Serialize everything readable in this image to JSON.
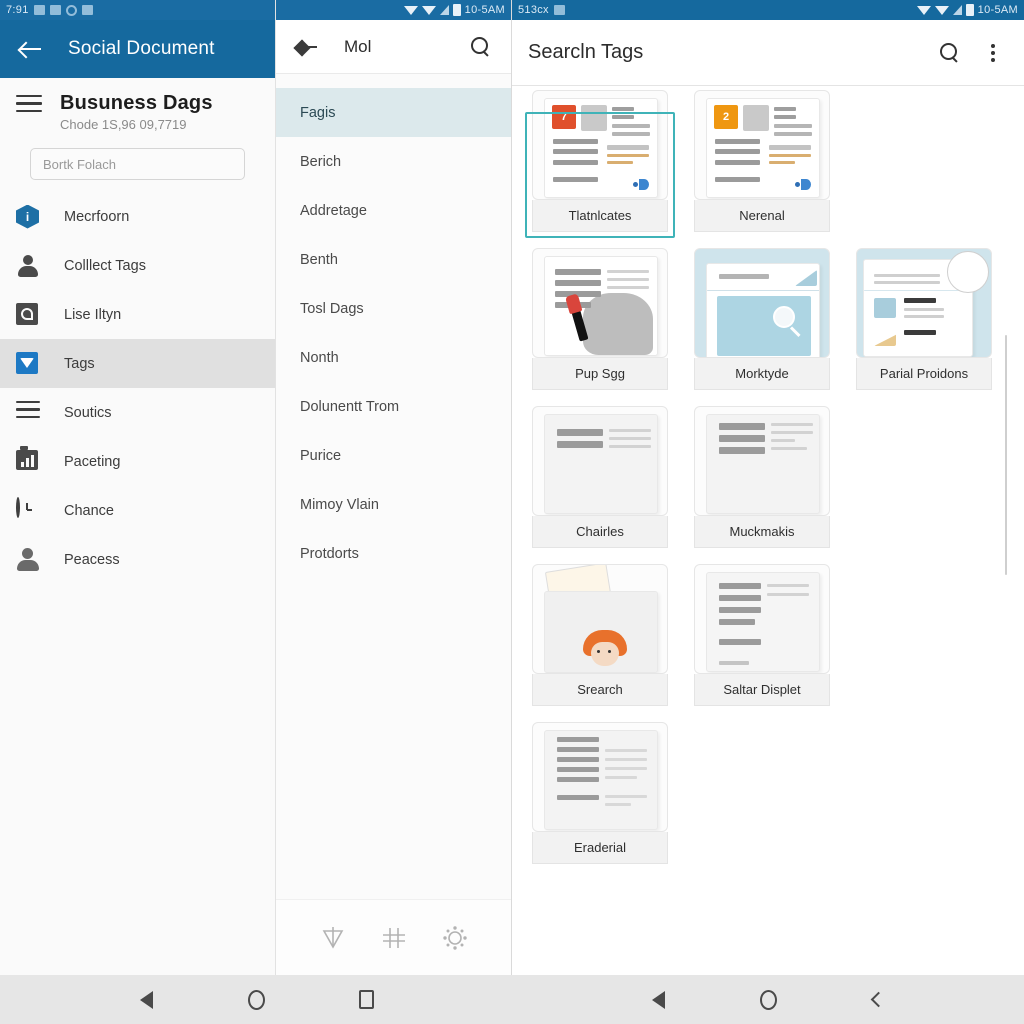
{
  "left_pane": {
    "status": {
      "time": "7:91",
      "icons": [
        "mail-icon",
        "save-icon",
        "sync-icon",
        "app-icon"
      ]
    },
    "appbar": {
      "back": "back-arrow",
      "title": "Social Document"
    },
    "header": {
      "menu": "hamburger-menu",
      "title": "Busuness Dags",
      "subtitle": "Chode 1S,96 09,7719"
    },
    "search": {
      "placeholder": "Bortk Folach",
      "value": ""
    },
    "items": [
      {
        "label": "Mecrfoorn",
        "icon": "info-hexagon-icon",
        "active": false
      },
      {
        "label": "Colllect Tags",
        "icon": "person-icon",
        "active": false
      },
      {
        "label": "Lise Iltyn",
        "icon": "square-leaf-icon",
        "active": false
      },
      {
        "label": "Tags",
        "icon": "twitter-bird-icon",
        "active": true
      },
      {
        "label": "Soutics",
        "icon": "list-lines-icon",
        "active": false
      },
      {
        "label": "Paceting",
        "icon": "bar-chart-icon",
        "active": false
      },
      {
        "label": "Chance",
        "icon": "clock-icon",
        "active": false
      },
      {
        "label": "Peacess",
        "icon": "contact-person-icon",
        "active": false
      }
    ]
  },
  "mid_pane": {
    "status": {
      "time": "10-5AM"
    },
    "appbar": {
      "back": "back-arrow",
      "title": "Mol",
      "search": "search-icon"
    },
    "items": [
      {
        "label": "Fagis",
        "selected": true
      },
      {
        "label": "Berich",
        "selected": false
      },
      {
        "label": "Addretage",
        "selected": false
      },
      {
        "label": "Benth",
        "selected": false
      },
      {
        "label": "Tosl Dags",
        "selected": false
      },
      {
        "label": "Nonth",
        "selected": false
      },
      {
        "label": "Dolunentt Trom",
        "selected": false
      },
      {
        "label": "Purice",
        "selected": false
      },
      {
        "label": "Mimoy Vlain",
        "selected": false
      },
      {
        "label": "Protdorts",
        "selected": false
      }
    ],
    "toolbar": [
      {
        "icon": "filter-triangle-icon"
      },
      {
        "icon": "grid-hash-icon"
      },
      {
        "icon": "settings-sun-icon"
      }
    ]
  },
  "right_pane": {
    "status": {
      "label": "513cx",
      "time": "10-5AM"
    },
    "appbar": {
      "title": "Searcln Tags",
      "search": "search-icon",
      "more": "kebab-menu-icon"
    },
    "cards": [
      [
        {
          "label": "Tlatnlcates",
          "type": "doc-badge",
          "badge": "7",
          "badge_color": "#e0502c",
          "selected": true,
          "tinted": false
        },
        {
          "label": "Nerenal",
          "type": "doc-badge",
          "badge": "2",
          "badge_color": "#ef9711",
          "selected": false,
          "tinted": false
        }
      ],
      [
        {
          "label": "Pup Sgg",
          "type": "doc-horse",
          "selected": false,
          "tinted": false
        },
        {
          "label": "Morktyde",
          "type": "doc-lens",
          "selected": false,
          "tinted": true
        },
        {
          "label": "Parial Proidons",
          "type": "doc-zoom",
          "selected": false,
          "tinted": true
        }
      ],
      [
        {
          "label": "Chairles",
          "type": "doc-plain",
          "selected": false,
          "tinted": false
        },
        {
          "label": "Muckmakis",
          "type": "doc-plain",
          "selected": false,
          "tinted": false
        }
      ],
      [
        {
          "label": "Srearch",
          "type": "doc-face",
          "selected": false,
          "tinted": false
        },
        {
          "label": "Saltar Displet",
          "type": "doc-plain",
          "selected": false,
          "tinted": false
        }
      ],
      [
        {
          "label": "Eraderial",
          "type": "doc-plain",
          "selected": false,
          "tinted": false
        }
      ]
    ]
  },
  "navbars": {
    "left": [
      {
        "icon": "nav-back-icon"
      },
      {
        "icon": "nav-home-icon"
      },
      {
        "icon": "nav-recents-icon"
      }
    ],
    "right": [
      {
        "icon": "nav-back-icon"
      },
      {
        "icon": "nav-home-icon"
      },
      {
        "icon": "nav-chevron-back-icon"
      }
    ]
  },
  "colors": {
    "appbar_blue": "#15699e",
    "selection_teal": "#3fb3b8",
    "mid_selected": "#dce9ec",
    "sidebar_active": "#e0e0e0"
  }
}
